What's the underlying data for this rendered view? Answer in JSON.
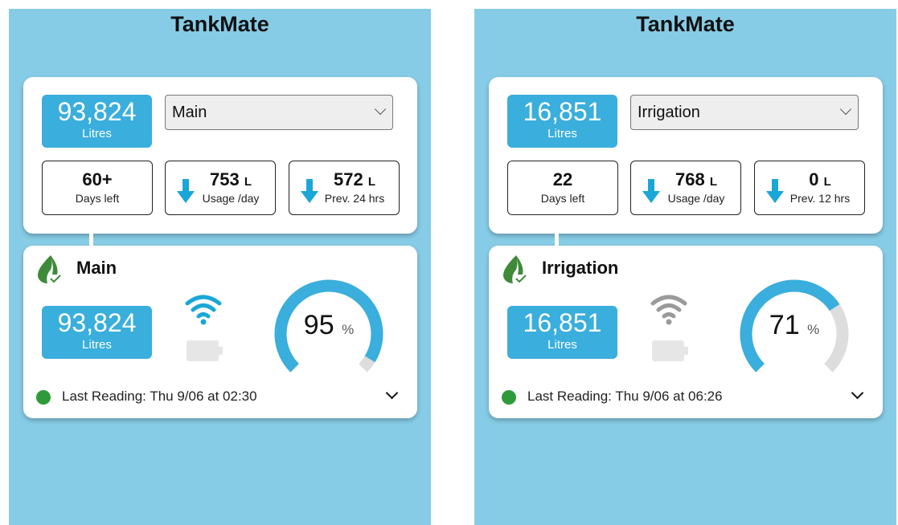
{
  "colors": {
    "accent": "#3aaedc",
    "background": "#87cce6",
    "ok": "#2e9a3a",
    "gauge_empty": "#dddddd"
  },
  "panels": [
    {
      "app_title": "TankMate",
      "total": {
        "value": "93,824",
        "unit": "Litres"
      },
      "tank_select": {
        "selected": "Main"
      },
      "stats": {
        "days": {
          "value": "60+",
          "label": "Days left"
        },
        "usage": {
          "value": "753",
          "unit": "L",
          "label": "Usage /day",
          "icon": "arrow-down-icon"
        },
        "prev": {
          "value": "572",
          "unit": "L",
          "label": "Prev. 24 hrs",
          "icon": "arrow-down-icon"
        }
      },
      "tank": {
        "name": "Main",
        "icon": "leaf-check-icon",
        "volume": "93,824",
        "unit": "Litres",
        "wifi_connected": true,
        "wifi_color": "#1aa7d8",
        "battery_icon": "battery-icon",
        "percent": 95,
        "percent_text": "95",
        "percent_unit": "%",
        "last_reading": "Last Reading: Thu 9/06 at 02:30"
      }
    },
    {
      "app_title": "TankMate",
      "total": {
        "value": "16,851",
        "unit": "Litres"
      },
      "tank_select": {
        "selected": "Irrigation"
      },
      "stats": {
        "days": {
          "value": "22",
          "label": "Days left"
        },
        "usage": {
          "value": "768",
          "unit": "L",
          "label": "Usage /day",
          "icon": "arrow-down-icon"
        },
        "prev": {
          "value": "0",
          "unit": "L",
          "label": "Prev. 12 hrs",
          "icon": "arrow-down-icon"
        }
      },
      "tank": {
        "name": "Irrigation",
        "icon": "leaf-check-icon",
        "volume": "16,851",
        "unit": "Litres",
        "wifi_connected": false,
        "wifi_color": "#9a9a9a",
        "battery_icon": "battery-icon",
        "percent": 71,
        "percent_text": "71",
        "percent_unit": "%",
        "last_reading": "Last Reading: Thu 9/06 at 06:26"
      }
    }
  ]
}
